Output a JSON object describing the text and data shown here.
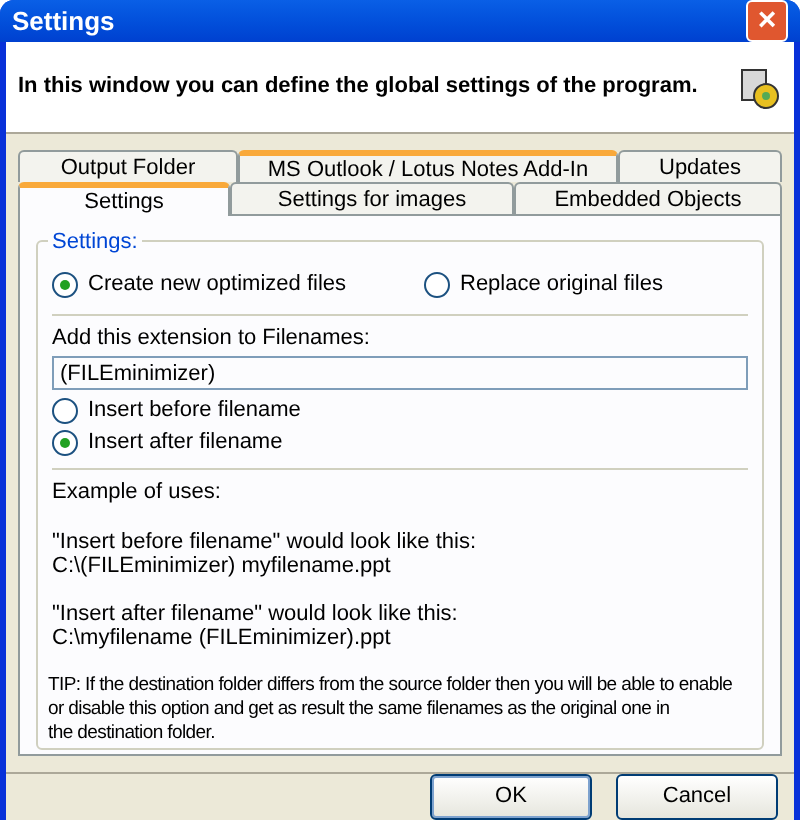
{
  "window": {
    "title": "Settings",
    "close": "×"
  },
  "header": {
    "text": "In this window you can define the global settings of the program."
  },
  "tab_rows": [
    [
      {
        "label": "Output Folder",
        "selected": false,
        "hovered": false
      },
      {
        "label": "MS Outlook / Lotus Notes Add-In",
        "selected": false,
        "hovered": true
      },
      {
        "label": "Updates",
        "selected": false,
        "hovered": false
      }
    ],
    [
      {
        "label": "Settings",
        "selected": true
      },
      {
        "label": "Settings for images",
        "selected": false,
        "hovered": false
      },
      {
        "label": "Embedded Objects",
        "selected": false,
        "hovered": false
      }
    ]
  ],
  "group": {
    "title": "Settings:",
    "mode_options": [
      {
        "label": "Create new optimized files",
        "selected": true
      },
      {
        "label": "Replace original files",
        "selected": false
      }
    ],
    "extension_label": "Add this extension to Filenames:",
    "extension_value": "(FILEminimizer)",
    "position_options": [
      {
        "label": "Insert before filename",
        "selected": false
      },
      {
        "label": "Insert after filename",
        "selected": true
      }
    ],
    "example_title": "Example of uses:",
    "examples": [
      {
        "caption": "\"Insert before filename\" would look like this:",
        "path": "C:\\(FILEminimizer) myfilename.ppt"
      },
      {
        "caption": "\"Insert after filename\" would look like this:",
        "path": "C:\\myfilename (FILEminimizer).ppt"
      }
    ],
    "tip": "TIP: If the destination folder differs from the source folder then you will be able to enable\nor disable this option and get as result the same filenames as the original one in\nthe destination folder."
  },
  "buttons": [
    "OK",
    "Cancel"
  ]
}
